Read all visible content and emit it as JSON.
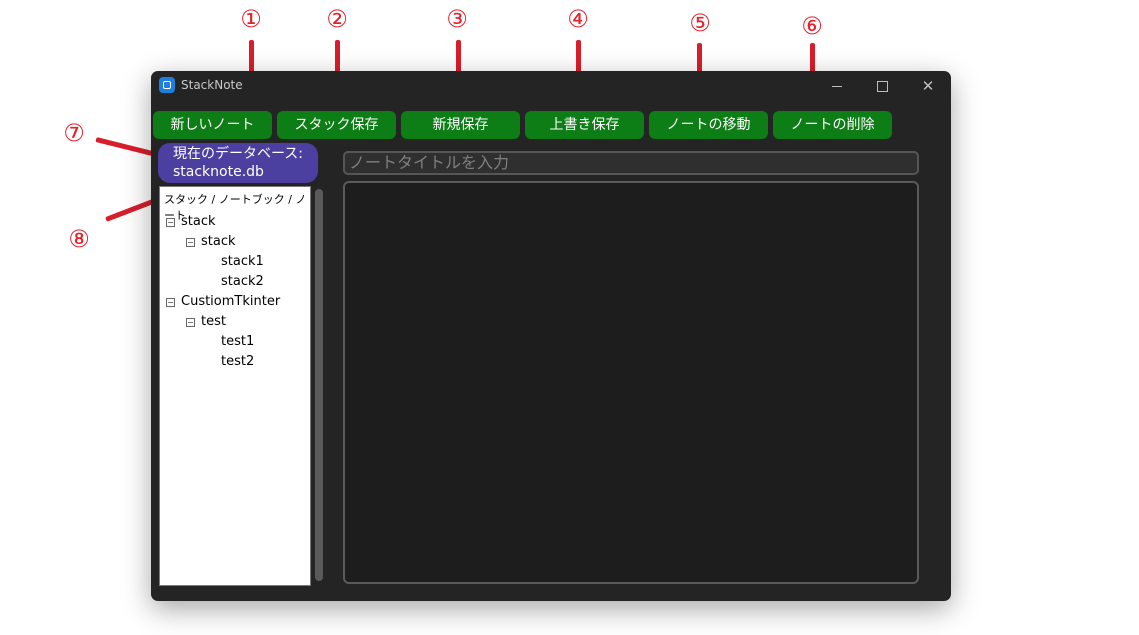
{
  "annotations": {
    "numbers": [
      "①",
      "②",
      "③",
      "④",
      "⑤",
      "⑥",
      "⑦",
      "⑧"
    ]
  },
  "window": {
    "title": "StackNote",
    "controls": {
      "minimize": "minimize-icon",
      "maximize": "maximize-icon",
      "close": "✕"
    }
  },
  "toolbar": {
    "buttons": [
      "新しいノート",
      "スタック保存",
      "新規保存",
      "上書き保存",
      "ノートの移動",
      "ノートの削除"
    ]
  },
  "database": {
    "label": "現在のデータベース:",
    "name": "stacknote.db"
  },
  "tree": {
    "header": "スタック / ノートブック / ノート",
    "nodes": [
      {
        "label": "stack",
        "toggle": "⊟"
      },
      {
        "label": "stack",
        "toggle": "⊟"
      },
      {
        "label": "stack1"
      },
      {
        "label": "stack2"
      },
      {
        "label": "CustiomTkinter",
        "toggle": "⊟"
      },
      {
        "label": "test",
        "toggle": "⊟"
      },
      {
        "label": "test1"
      },
      {
        "label": "test2"
      }
    ]
  },
  "editor": {
    "title_placeholder": "ノートタイトルを入力",
    "body": ""
  },
  "colors": {
    "button_green": "#0d7d16",
    "db_badge": "#4b3fa0",
    "window_bg": "#242424",
    "annotation_red": "#d81e2a"
  }
}
